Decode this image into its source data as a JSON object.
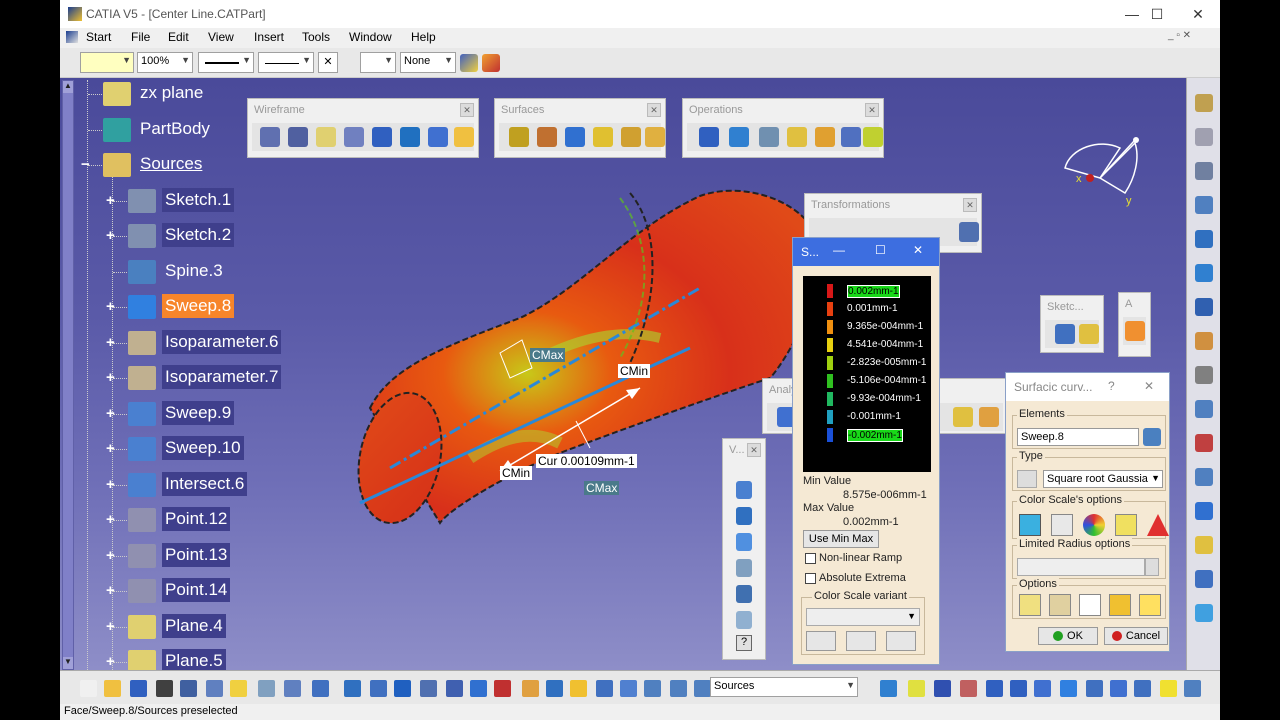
{
  "window": {
    "title": "CATIA V5 - [Center Line.CATPart]",
    "minimize": "—",
    "maximize": "☐",
    "close": "✕"
  },
  "menu": [
    "Start",
    "File",
    "Edit",
    "View",
    "Insert",
    "Tools",
    "Window",
    "Help"
  ],
  "toolbar": {
    "zoom": "100%",
    "layer": "None"
  },
  "tree": [
    {
      "label": "zx plane",
      "style": "plain"
    },
    {
      "label": "PartBody",
      "style": "plain"
    },
    {
      "label": "Sources",
      "style": "plain"
    },
    {
      "label": "Sketch.1",
      "style": "dark"
    },
    {
      "label": "Sketch.2",
      "style": "dark"
    },
    {
      "label": "Spine.3",
      "style": "plain"
    },
    {
      "label": "Sweep.8",
      "style": "selected"
    },
    {
      "label": "Isoparameter.6",
      "style": "dark"
    },
    {
      "label": "Isoparameter.7",
      "style": "dark"
    },
    {
      "label": "Sweep.9",
      "style": "dark"
    },
    {
      "label": "Sweep.10",
      "style": "dark"
    },
    {
      "label": "Intersect.6",
      "style": "dark"
    },
    {
      "label": "Point.12",
      "style": "dark"
    },
    {
      "label": "Point.13",
      "style": "dark"
    },
    {
      "label": "Point.14",
      "style": "dark"
    },
    {
      "label": "Plane.4",
      "style": "dark"
    },
    {
      "label": "Plane.5",
      "style": "dark"
    }
  ],
  "toolbars": {
    "wireframe": "Wireframe",
    "surfaces": "Surfaces",
    "operations": "Operations",
    "transformations": "Transformations",
    "sketch": "Sketc...",
    "analysis": "Analy",
    "a_small": "A",
    "v_small": "V..."
  },
  "viewport": {
    "labels": {
      "cmax1": "CMax",
      "cmin1": "CMin",
      "cmin2": "CMin",
      "cur": "Cur 0.00109mm-1",
      "cmax2": "CMax"
    },
    "compass": {
      "x": "x",
      "y": "y"
    }
  },
  "color_scale_dialog": {
    "title": "S...",
    "values": [
      {
        "label": "0.002mm-1",
        "color": "#d81818",
        "highlight": true
      },
      {
        "label": "0.001mm-1",
        "color": "#e84010",
        "highlight": false
      },
      {
        "label": "9.365e-004mm-1",
        "color": "#f09010",
        "highlight": false
      },
      {
        "label": "4.541e-004mm-1",
        "color": "#e8d010",
        "highlight": false
      },
      {
        "label": "-2.823e-005mm-1",
        "color": "#a0d010",
        "highlight": false
      },
      {
        "label": "-5.106e-004mm-1",
        "color": "#30c020",
        "highlight": false
      },
      {
        "label": "-9.93e-004mm-1",
        "color": "#20b860",
        "highlight": false
      },
      {
        "label": "-0.001mm-1",
        "color": "#20a0c0",
        "highlight": false
      },
      {
        "label": "-0.002mm-1",
        "color": "#1a50d8",
        "highlight": true
      }
    ],
    "min_label": "Min Value",
    "min_value": "8.575e-006mm-1",
    "max_label": "Max Value",
    "max_value": "0.002mm-1",
    "use_min_max": "Use Min Max",
    "non_linear": "Non-linear Ramp",
    "absolute": "Absolute Extrema",
    "variant": "Color Scale variant"
  },
  "surfacic_dialog": {
    "title": "Surfacic curv...",
    "help": "?",
    "close": "✕",
    "elements_label": "Elements",
    "elements_value": "Sweep.8",
    "type_label": "Type",
    "type_value": "Square root Gaussia",
    "color_scale_options": "Color Scale's options",
    "limited_radius": "Limited Radius options",
    "options": "Options",
    "ok": "OK",
    "cancel": "Cancel"
  },
  "bottom": {
    "sources_combo": "Sources",
    "status": "Face/Sweep.8/Sources preselected"
  }
}
